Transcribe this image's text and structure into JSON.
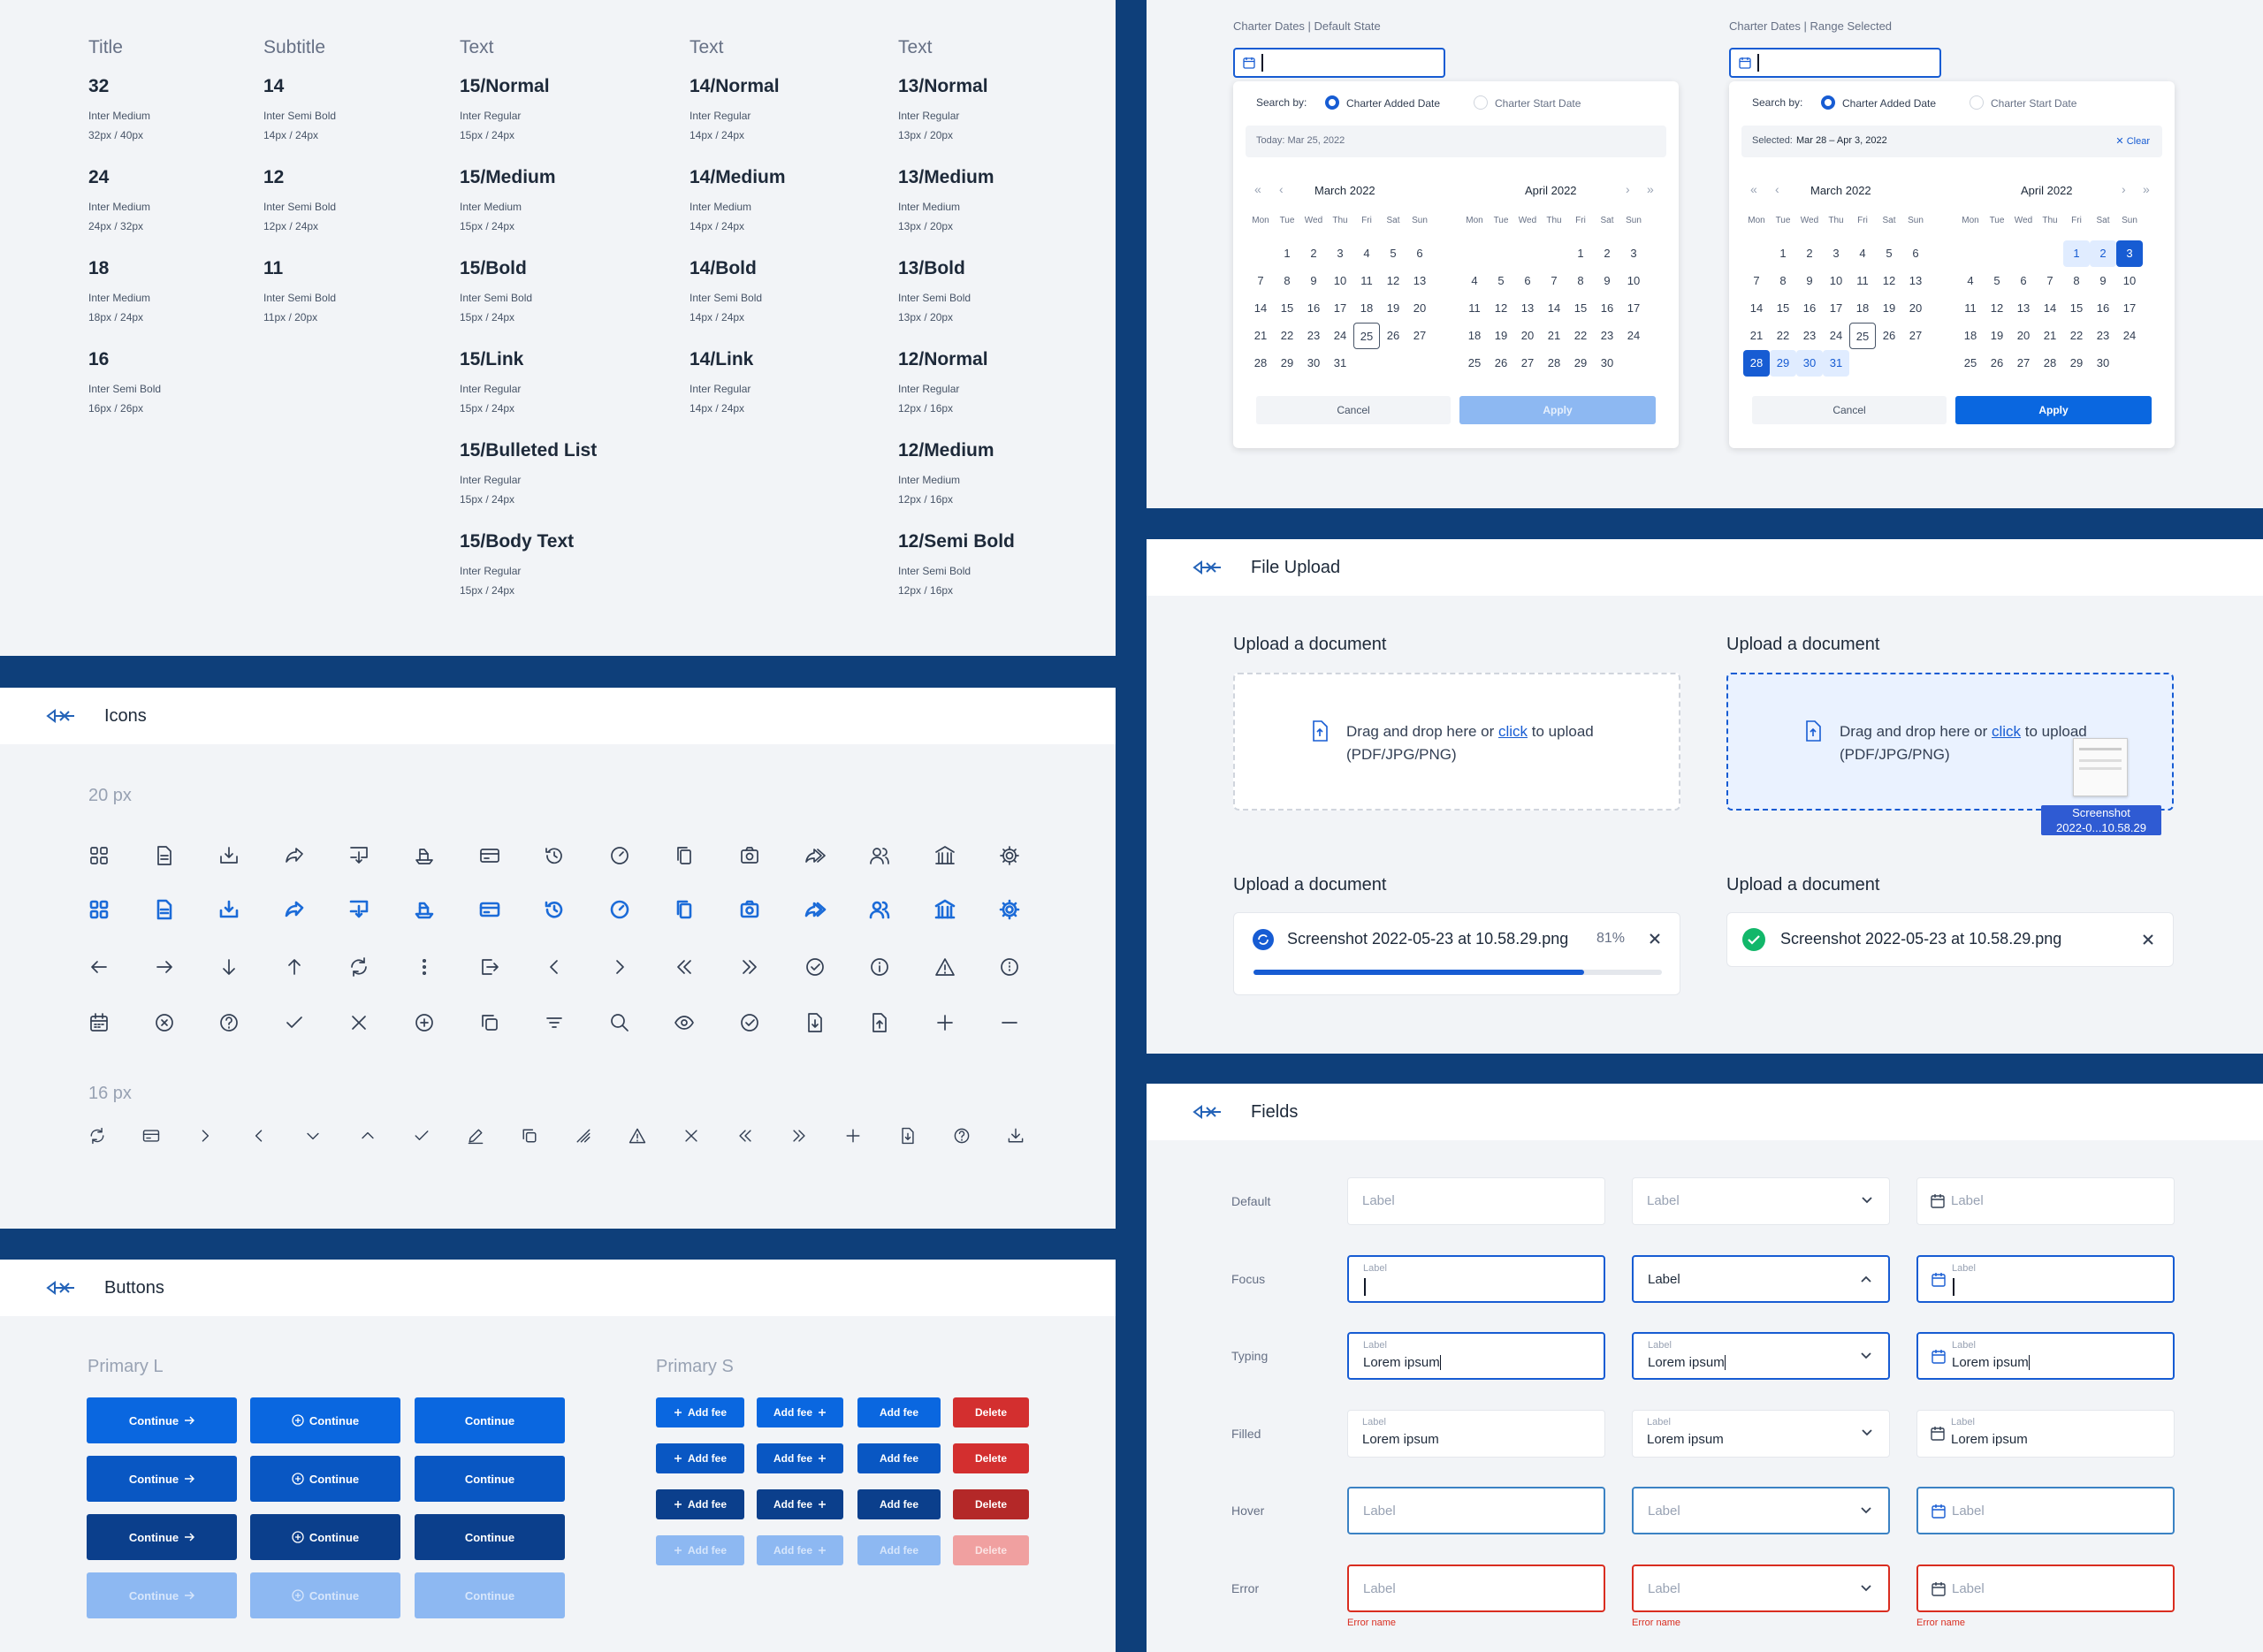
{
  "typography": {
    "columns": [
      {
        "header": "Title",
        "items": [
          {
            "name": "32",
            "font": "Inter Medium",
            "size": "32px / 40px"
          },
          {
            "name": "24",
            "font": "Inter Medium",
            "size": "24px / 32px"
          },
          {
            "name": "18",
            "font": "Inter Medium",
            "size": "18px / 24px"
          },
          {
            "name": "16",
            "font": "Inter Semi Bold",
            "size": "16px / 26px"
          }
        ]
      },
      {
        "header": "Subtitle",
        "items": [
          {
            "name": "14",
            "font": "Inter Semi Bold",
            "size": "14px / 24px"
          },
          {
            "name": "12",
            "font": "Inter Semi Bold",
            "size": "12px / 24px"
          },
          {
            "name": "11",
            "font": "Inter Semi Bold",
            "size": "11px / 20px"
          }
        ]
      },
      {
        "header": "Text",
        "items": [
          {
            "name": "15/Normal",
            "font": "Inter Regular",
            "size": "15px / 24px"
          },
          {
            "name": "15/Medium",
            "font": "Inter Medium",
            "size": "15px / 24px"
          },
          {
            "name": "15/Bold",
            "font": "Inter Semi Bold",
            "size": "15px / 24px"
          },
          {
            "name": "15/Link",
            "font": "Inter Regular",
            "size": "15px / 24px"
          },
          {
            "name": "15/Bulleted List",
            "font": "Inter Regular",
            "size": "15px / 24px"
          },
          {
            "name": "15/Body Text",
            "font": "Inter Regular",
            "size": "15px / 24px"
          }
        ]
      },
      {
        "header": "Text",
        "items": [
          {
            "name": "14/Normal",
            "font": "Inter Regular",
            "size": "14px / 24px"
          },
          {
            "name": "14/Medium",
            "font": "Inter Medium",
            "size": "14px / 24px"
          },
          {
            "name": "14/Bold",
            "font": "Inter Semi Bold",
            "size": "14px / 24px"
          },
          {
            "name": "14/Link",
            "font": "Inter Regular",
            "size": "14px / 24px"
          }
        ]
      },
      {
        "header": "Text",
        "items": [
          {
            "name": "13/Normal",
            "font": "Inter Regular",
            "size": "13px / 20px"
          },
          {
            "name": "13/Medium",
            "font": "Inter Medium",
            "size": "13px / 20px"
          },
          {
            "name": "13/Bold",
            "font": "Inter Semi Bold",
            "size": "13px / 20px"
          },
          {
            "name": "12/Normal",
            "font": "Inter Regular",
            "size": "12px / 16px"
          },
          {
            "name": "12/Medium",
            "font": "Inter Medium",
            "size": "12px / 16px"
          },
          {
            "name": "12/Semi Bold",
            "font": "Inter Semi Bold",
            "size": "12px / 16px"
          }
        ]
      }
    ]
  },
  "icons_panel": {
    "title": "Icons",
    "size20": "20 px",
    "size16": "16 px",
    "row1": [
      "grid",
      "document",
      "download-box",
      "share",
      "download-screen",
      "ship",
      "card",
      "history",
      "speed",
      "copy",
      "camera",
      "forward",
      "users",
      "bank",
      "settings"
    ],
    "row3": [
      "arrow-left",
      "arrow-right",
      "arrow-down",
      "arrow-up",
      "refresh",
      "more-vertical",
      "exit",
      "chevron-left",
      "chevron-right",
      "double-left",
      "double-right",
      "check-circle",
      "info",
      "warning",
      "more-circle"
    ],
    "row4": [
      "calendar",
      "x-circle",
      "help",
      "check",
      "close",
      "plus-circle",
      "duplicate",
      "filter",
      "search",
      "eye",
      "check-circle-2",
      "doc-download",
      "doc-upload",
      "plus",
      "minus"
    ],
    "row16": [
      "refresh",
      "card",
      "chevron-right",
      "chevron-left",
      "chevron-down",
      "chevron-up",
      "check",
      "edit",
      "duplicate",
      "slash",
      "warning",
      "close",
      "double-left",
      "double-right",
      "plus",
      "doc-download",
      "help",
      "download"
    ]
  },
  "buttons_panel": {
    "title": "Buttons",
    "primary_l": "Primary L",
    "primary_s": "Primary S",
    "continue": "Continue",
    "add_fee": "Add fee",
    "delete": "Delete",
    "colors": {
      "default": "#0a67e0",
      "hover": "#0957c3",
      "pressed": "#0b3f8c",
      "disabled": "#8db8f2",
      "danger": "#d32f2f",
      "danger_pressed": "#b42828",
      "danger_disabled": "#f0a0a0"
    }
  },
  "calendar": {
    "default_title": "Charter Dates | Default State",
    "range_title": "Charter Dates | Range Selected",
    "search_by": "Search by:",
    "opt1": "Charter Added Date",
    "opt2": "Charter Start Date",
    "today": "Today: Mar 25, 2022",
    "selected_prefix": "Selected:",
    "selected": "Mar 28 – Apr 3, 2022",
    "clear": "Clear",
    "march": "March 2022",
    "april": "April 2022",
    "weekdays": [
      "Mon",
      "Tue",
      "Wed",
      "Thu",
      "Fri",
      "Sat",
      "Sun"
    ],
    "cancel": "Cancel",
    "apply": "Apply"
  },
  "upload": {
    "title": "File Upload",
    "label": "Upload a document",
    "drop_pre": "Drag and drop here or ",
    "drop_link": "click",
    "drop_post": " to upload",
    "drop_types": "(PDF/JPG/PNG)",
    "file": "Screenshot 2022-05-23 at 10.58.29.png",
    "progress": "81%",
    "progress_value": 0.81,
    "drag_tag1": "Screenshot",
    "drag_tag2": "2022-0...10.58.29"
  },
  "fields": {
    "title": "Fields",
    "states": [
      "Default",
      "Focus",
      "Typing",
      "Filled",
      "Hover",
      "Error"
    ],
    "label": "Label",
    "value": "Lorem ipsum",
    "error": "Error name"
  }
}
